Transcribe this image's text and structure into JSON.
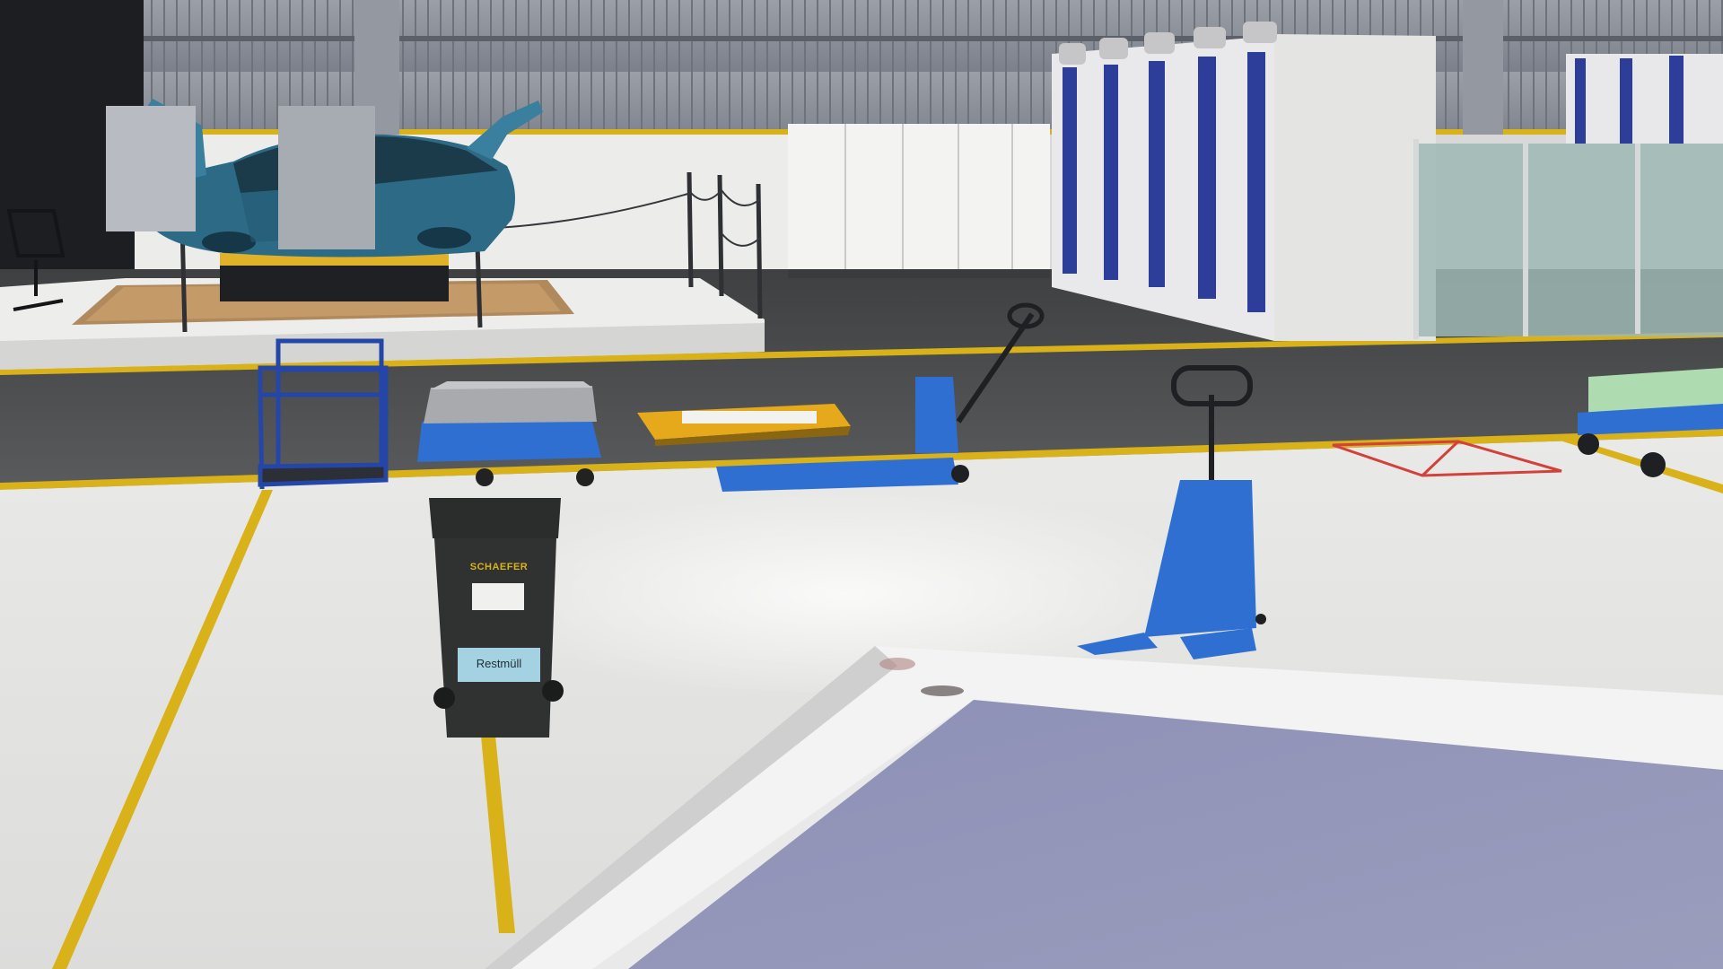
{
  "scene": {
    "bin": {
      "brand_label": "SCHAEFER",
      "sign_label": "Restmüll"
    }
  },
  "colors": {
    "floor": "#e6e6e4",
    "aisle": "#4a4b4d",
    "line_yellow": "#d9b21a",
    "pallet_jack_blue": "#2f6fd1",
    "wall": "#8a8f98",
    "car_body": "#2c6a86",
    "bin": "#2b2d2c",
    "platform_top": "#8c8fb2"
  }
}
